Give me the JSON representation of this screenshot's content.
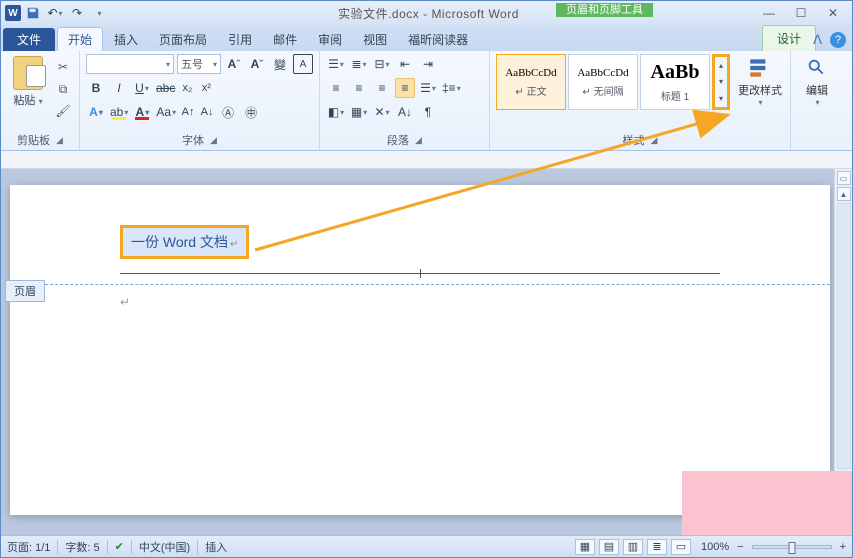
{
  "title": "实验文件.docx - Microsoft Word",
  "context_tool": "页眉和页脚工具",
  "tabs": {
    "file": "文件",
    "home": "开始",
    "insert": "插入",
    "layout": "页面布局",
    "ref": "引用",
    "mail": "邮件",
    "review": "审阅",
    "view": "视图",
    "foxit": "福昕阅读器",
    "design": "设计"
  },
  "groups": {
    "clipboard": "剪贴板",
    "font": "字体",
    "paragraph": "段落",
    "styles": "样式",
    "editing": "编辑"
  },
  "clipboard": {
    "paste": "粘贴"
  },
  "font": {
    "name_placeholder": "",
    "size": "五号"
  },
  "styles": {
    "items": [
      {
        "sample": "AaBbCcDd",
        "caption": "↵ 正文"
      },
      {
        "sample": "AaBbCcDd",
        "caption": "↵ 无间隔"
      },
      {
        "sample": "AaBb",
        "caption": "标题 1"
      }
    ],
    "change": "更改样式"
  },
  "header": {
    "text": "一份 Word 文档",
    "tag": "页眉"
  },
  "status": {
    "page": "页面: 1/1",
    "words": "字数: 5",
    "lang": "中文(中国)",
    "mode": "插入",
    "zoom": "100%"
  }
}
